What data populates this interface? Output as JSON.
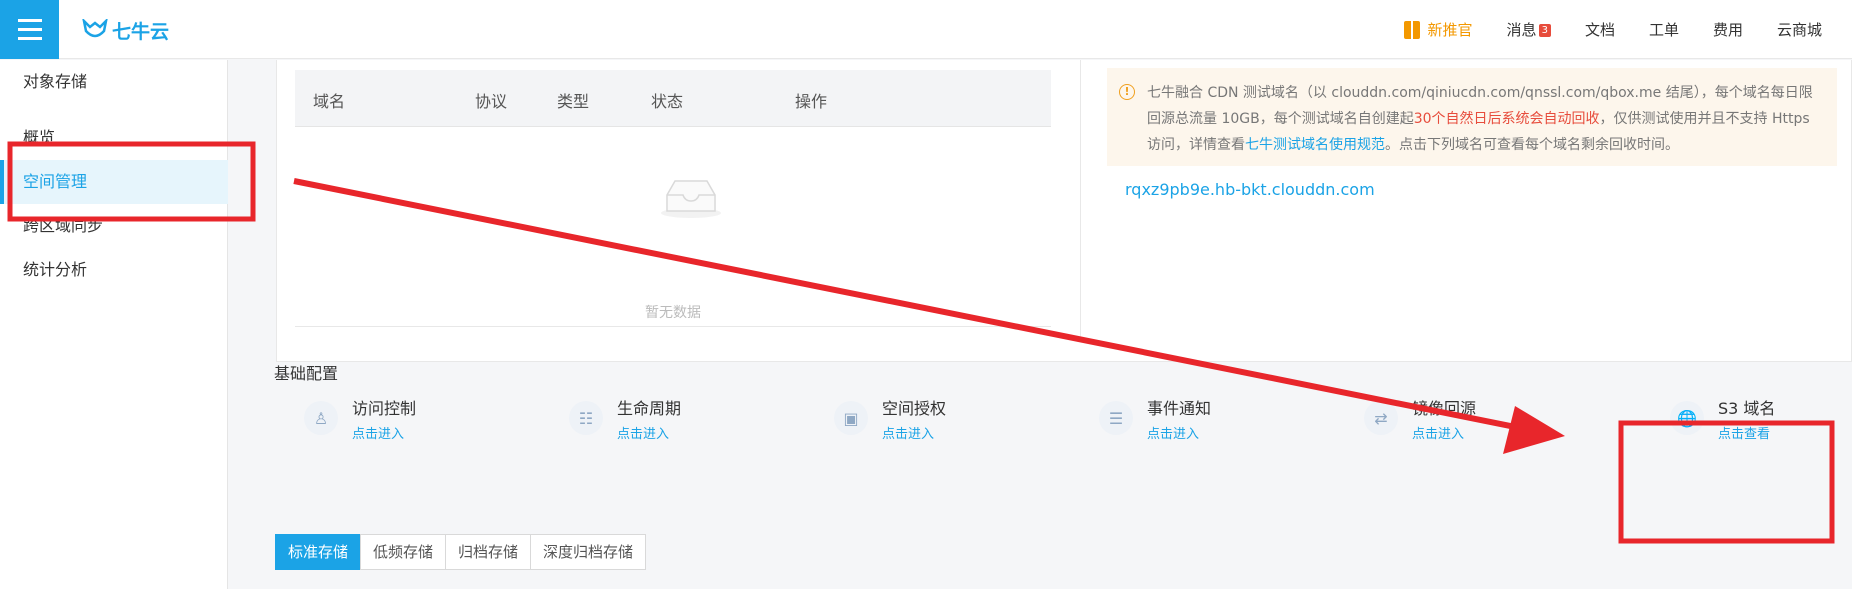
{
  "app": {
    "logo_text": "七牛云",
    "accent": "#1ba3e6"
  },
  "topnav": {
    "promo": "新推官",
    "messages": "消息",
    "messages_count": "3",
    "docs": "文档",
    "tickets": "工单",
    "billing": "费用",
    "mall": "云商城"
  },
  "sidebar": {
    "items": [
      {
        "label": "对象存储"
      },
      {
        "label": "概览"
      },
      {
        "label": "空间管理"
      },
      {
        "label": "跨区域同步"
      },
      {
        "label": "统计分析"
      }
    ]
  },
  "domain_table": {
    "headers": [
      "域名",
      "协议",
      "类型",
      "状态",
      "操作"
    ],
    "empty_text": "暂无数据"
  },
  "notice": {
    "part1": "七牛融合 CDN 测试域名（以 clouddn.com/qiniucdn.com/qnssl.com/qbox.me 结尾），每个域名每日限回源总流量 10GB，每个测试域名自创建起",
    "red": "30个自然日后系统会自动回收",
    "part2": "，仅供测试使用并且不支持 Https 访问，详情查看",
    "link": "七牛测试域名使用规范",
    "part3": "。点击下列域名可查看每个域名剩余回收时间。"
  },
  "test_domain": "rqxz9pb9e.hb-bkt.clouddn.com",
  "basic_config": {
    "title": "基础配置",
    "items": [
      {
        "name": "访问控制",
        "action": "点击进入",
        "icon": "user-lock-icon"
      },
      {
        "name": "生命周期",
        "action": "点击进入",
        "icon": "calendar-icon"
      },
      {
        "name": "空间授权",
        "action": "点击进入",
        "icon": "box-icon"
      },
      {
        "name": "事件通知",
        "action": "点击进入",
        "icon": "clipboard-icon"
      },
      {
        "name": "镜像回源",
        "action": "点击进入",
        "icon": "mirror-icon"
      },
      {
        "name": "S3 域名",
        "action": "点击查看",
        "icon": "globe-icon"
      }
    ]
  },
  "storage_tabs": [
    "标准存储",
    "低频存储",
    "归档存储",
    "深度归档存储"
  ],
  "annotation_color": "#e8262b"
}
